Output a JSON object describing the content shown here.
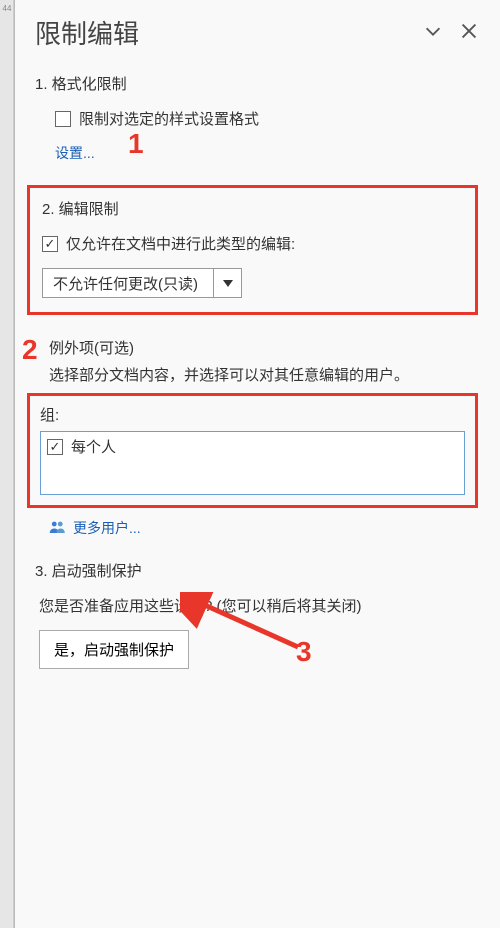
{
  "left_strip_marker": "44",
  "panel": {
    "title": "限制编辑"
  },
  "section1": {
    "title": "1. 格式化限制",
    "checkbox_label": "限制对选定的样式设置格式",
    "settings_link": "设置..."
  },
  "section2": {
    "title": "2. 编辑限制",
    "checkbox_label": "仅允许在文档中进行此类型的编辑:",
    "combo_value": "不允许任何更改(只读)"
  },
  "exceptions": {
    "title": "例外项(可选)",
    "hint": "选择部分文档内容，并选择可以对其任意编辑的用户。",
    "groups_label": "组:",
    "group_item": "每个人",
    "more_users": "更多用户..."
  },
  "section3": {
    "title": "3. 启动强制保护",
    "hint": "您是否准备应用这些设置? (您可以稍后将其关闭)",
    "button_label": "是，启动强制保护"
  },
  "annotations": {
    "one": "1",
    "two": "2",
    "three": "3"
  }
}
